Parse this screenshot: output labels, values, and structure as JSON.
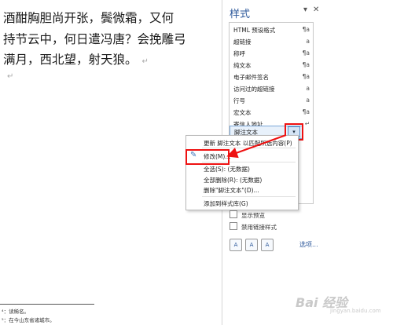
{
  "document": {
    "poem_lines": [
      "酒酣胸胆尚开张，鬓微霜，又何",
      "持节云中，何日遣冯唐？会挽雕弓",
      "满月，西北望，射天狼。"
    ],
    "paragraph_mark": "↵",
    "footnotes": [
      "⁴：读稀名。",
      "⁵：在今山东省诸城市。"
    ]
  },
  "styles_pane": {
    "title": "样式",
    "dropdown_btn": "▾",
    "close_btn": "✕",
    "items": [
      {
        "label": "HTML 预设格式",
        "icon": "¶a"
      },
      {
        "label": "超链接",
        "icon": "a"
      },
      {
        "label": "称呼",
        "icon": "¶a"
      },
      {
        "label": "纯文本",
        "icon": "¶a"
      },
      {
        "label": "电子邮件签名",
        "icon": "¶a"
      },
      {
        "label": "访问过的超链接",
        "icon": "a"
      },
      {
        "label": "行号",
        "icon": "a"
      },
      {
        "label": "宏文本",
        "icon": "¶a"
      },
      {
        "label": "寄信人地址",
        "icon": "↵"
      },
      {
        "label": "脚注文本",
        "icon": "▾"
      }
    ],
    "selected_item_dropdown": "▾",
    "checkboxes": [
      "显示预览",
      "禁用链接样式"
    ],
    "tool_buttons": [
      "A",
      "A",
      "A"
    ],
    "options_link": "选项..."
  },
  "context_menu": {
    "items": [
      "更新 脚注文本 以匹配所选内容(P)",
      "修改(M)...",
      "全选(S): (无数据)",
      "全部删除(R): (无数据)",
      "删除\"脚注文本\"(D)...",
      "添加到样式库(G)"
    ]
  },
  "watermark": {
    "text": "Bai 经验",
    "sub": "jingyan.baidu.com"
  },
  "colors": {
    "accent": "#2b579a",
    "highlight": "#e11111"
  }
}
